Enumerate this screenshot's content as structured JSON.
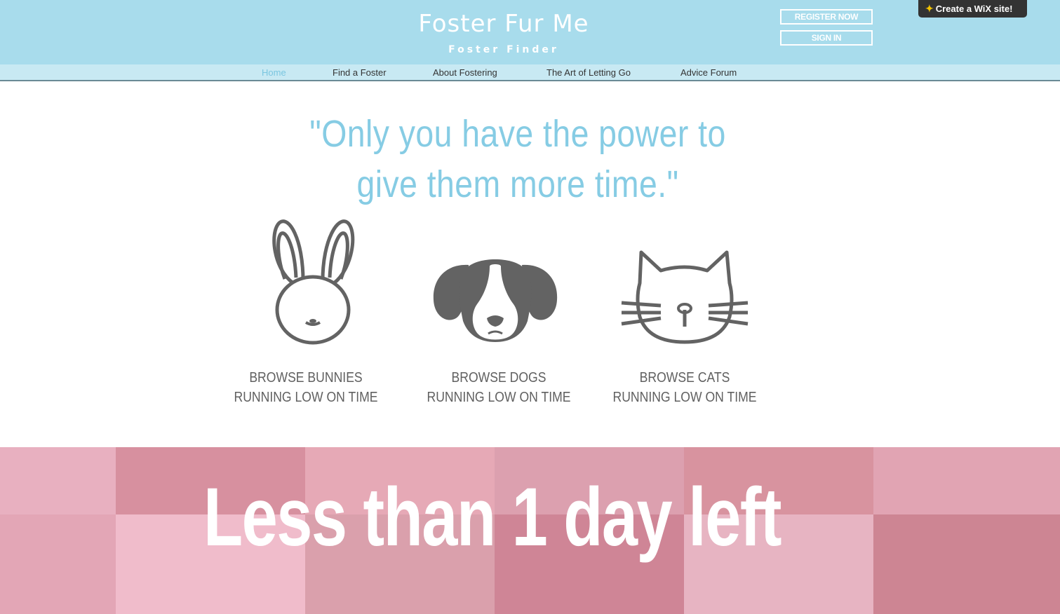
{
  "header": {
    "title": "Foster Fur Me",
    "subtitle": "Foster Finder",
    "register_label": "REGISTER NOW",
    "signin_label": "SIGN IN",
    "wix_badge": "Create a WiX site!"
  },
  "nav": {
    "items": [
      {
        "label": "Home",
        "active": true
      },
      {
        "label": "Find a Foster"
      },
      {
        "label": "About Fostering"
      },
      {
        "label": "The Art of Letting Go"
      },
      {
        "label": "Advice Forum"
      }
    ]
  },
  "quote": {
    "line1": "\"Only you have the power to",
    "line2": "give them more time.\""
  },
  "animals": [
    {
      "icon": "bunny-icon",
      "title": "BROWSE BUNNIES",
      "subtitle": "RUNNING LOW ON TIME"
    },
    {
      "icon": "dog-icon",
      "title": "BROWSE DOGS",
      "subtitle": "RUNNING LOW ON TIME"
    },
    {
      "icon": "cat-icon",
      "title": "BROWSE CATS",
      "subtitle": "RUNNING LOW ON TIME"
    }
  ],
  "banner": {
    "text": "Less than 1 day left"
  },
  "colors": {
    "header_bg": "#a8dcec",
    "nav_bg": "#c8e9f3",
    "accent": "#86cce4",
    "icon_gray": "#636363",
    "banner_pink": "#e9a9bc"
  }
}
